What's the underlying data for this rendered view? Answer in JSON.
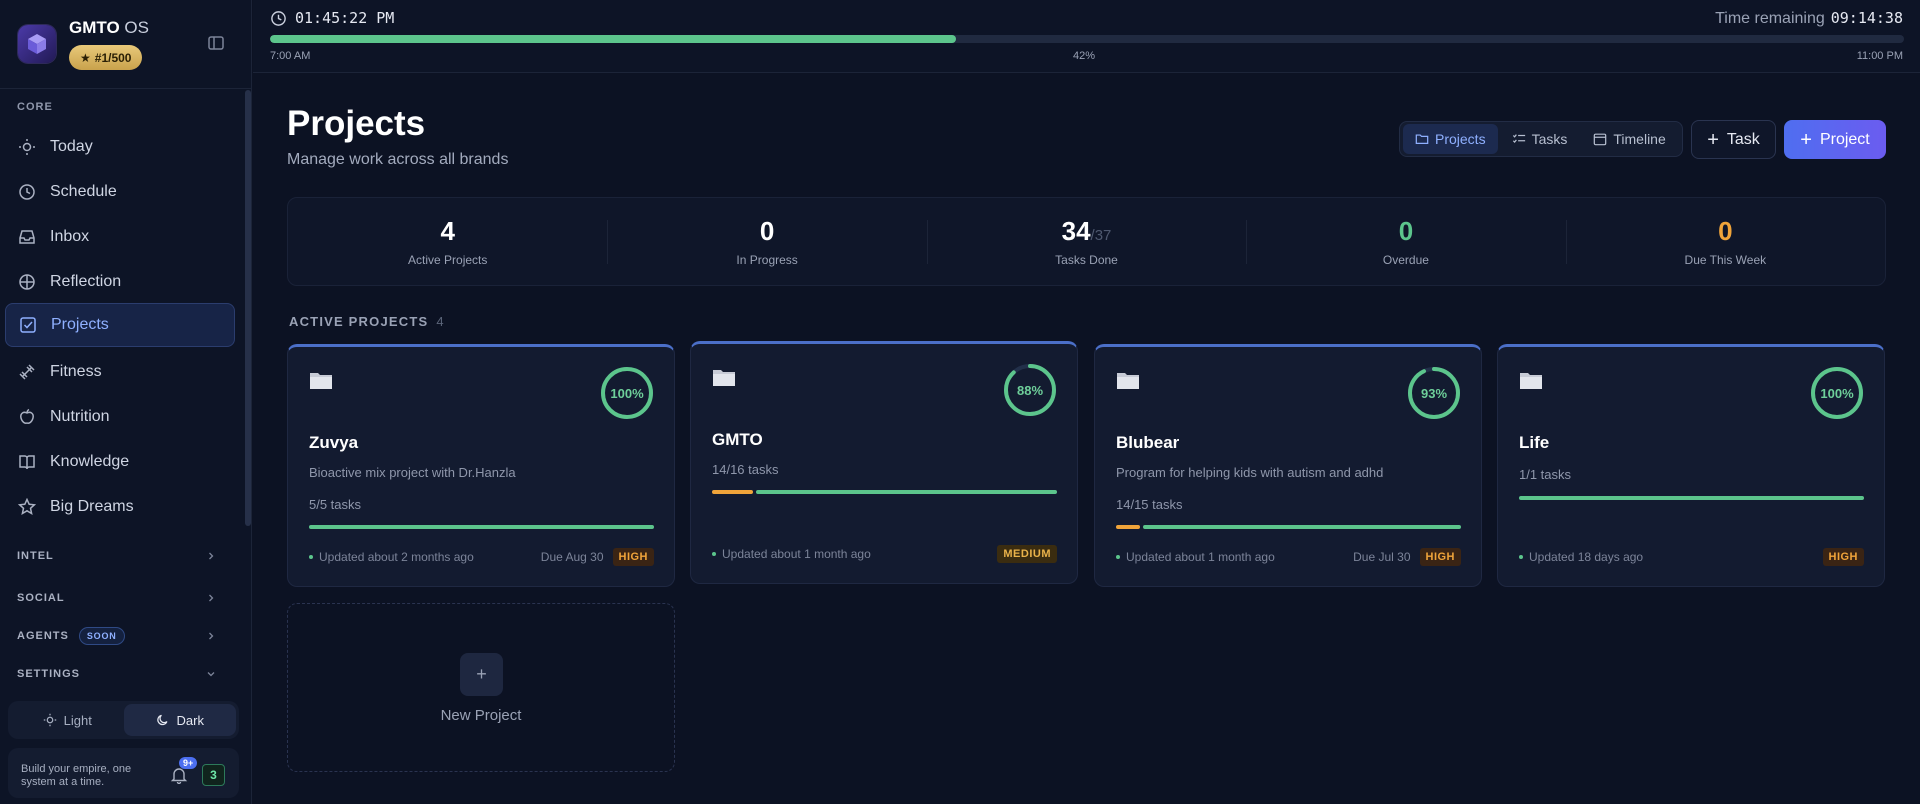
{
  "brand": {
    "name_bold": "GMTO",
    "name_rest": " OS",
    "rank": "#1/500"
  },
  "sidebar": {
    "core_label": "CORE",
    "items": [
      {
        "label": "Today",
        "icon": "sun-icon"
      },
      {
        "label": "Schedule",
        "icon": "clock-icon"
      },
      {
        "label": "Inbox",
        "icon": "inbox-icon"
      },
      {
        "label": "Reflection",
        "icon": "target-icon"
      },
      {
        "label": "Projects",
        "icon": "checkbox-icon",
        "active": true
      },
      {
        "label": "Fitness",
        "icon": "dumbbell-icon"
      },
      {
        "label": "Nutrition",
        "icon": "apple-icon"
      },
      {
        "label": "Knowledge",
        "icon": "book-icon"
      },
      {
        "label": "Big Dreams",
        "icon": "star-icon"
      }
    ],
    "groups": [
      {
        "label": "INTEL"
      },
      {
        "label": "SOCIAL"
      },
      {
        "label": "AGENTS",
        "badge": "SOON"
      },
      {
        "label": "SETTINGS"
      }
    ],
    "theme": {
      "light": "Light",
      "dark": "Dark",
      "selected": "Dark"
    },
    "footer": {
      "tagline": "Build your empire, one system at a time.",
      "notifications": "9+",
      "count": "3"
    }
  },
  "topbar": {
    "clock": "01:45:22 PM",
    "remaining_label": "Time remaining",
    "remaining_value": "09:14:38",
    "progress_label": "42%",
    "progress_fraction": 0.42,
    "start": "7:00 AM",
    "end": "11:00 PM"
  },
  "page": {
    "title": "Projects",
    "subtitle": "Manage work across all brands",
    "views": [
      "Projects",
      "Tasks",
      "Timeline"
    ],
    "selected_view": "Projects",
    "add_task": "Task",
    "add_project": "Project"
  },
  "stats": [
    {
      "value": "4",
      "label": "Active Projects"
    },
    {
      "value": "0",
      "label": "In Progress"
    },
    {
      "value": "34",
      "of": "/37",
      "label": "Tasks Done"
    },
    {
      "value": "0",
      "label": "Overdue",
      "color": "#5cc58c"
    },
    {
      "value": "0",
      "label": "Due This Week",
      "color": "#f0a43a"
    }
  ],
  "section": {
    "title": "ACTIVE PROJECTS",
    "count": "4"
  },
  "projects": [
    {
      "name": "Zuvya",
      "desc": "Bioactive mix project with Dr.Hanzla",
      "tasks": "5/5 tasks",
      "percent": "100%",
      "progress": 1.0,
      "updated": "Updated about 2 months ago",
      "due": "Due Aug 30",
      "priority": "HIGH"
    },
    {
      "name": "GMTO",
      "desc": "",
      "tasks": "14/16 tasks",
      "percent": "88%",
      "progress": 0.88,
      "updated": "Updated about 1 month ago",
      "due": "",
      "priority": "MEDIUM"
    },
    {
      "name": "Blubear",
      "desc": "Program for helping kids with autism and adhd",
      "tasks": "14/15 tasks",
      "percent": "93%",
      "progress": 0.93,
      "updated": "Updated about 1 month ago",
      "due": "Due Jul 30",
      "priority": "HIGH"
    },
    {
      "name": "Life",
      "desc": "",
      "tasks": "1/1 tasks",
      "percent": "100%",
      "progress": 1.0,
      "updated": "Updated 18 days ago",
      "due": "",
      "priority": "HIGH"
    }
  ],
  "new_project": {
    "label": "New Project",
    "plus": "+"
  },
  "colors": {
    "accent": "#4f6ef0",
    "progress": "#5cc58c",
    "amber": "#f0a43a",
    "bg": "#0c1223"
  }
}
